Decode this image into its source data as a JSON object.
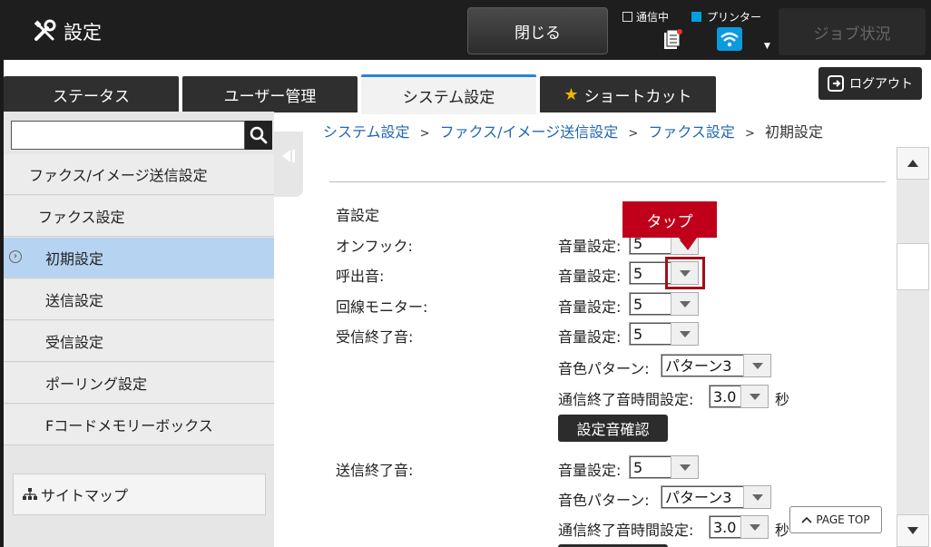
{
  "header": {
    "app_title": "設定",
    "close_label": "閉じる",
    "status_comm": "通信中",
    "status_printer": "プリンター",
    "job_status_label": "ジョブ状況"
  },
  "tabs": [
    {
      "label": "ステータス"
    },
    {
      "label": "ユーザー管理"
    },
    {
      "label": "システム設定"
    },
    {
      "label": "ショートカット"
    }
  ],
  "logout_label": "ログアウト",
  "search": {
    "value": "",
    "placeholder": ""
  },
  "sidebar": {
    "items": [
      {
        "label": "ファクス/イメージ送信設定"
      },
      {
        "label": "ファクス設定"
      },
      {
        "label": "初期設定"
      },
      {
        "label": "送信設定"
      },
      {
        "label": "受信設定"
      },
      {
        "label": "ポーリング設定"
      },
      {
        "label": "Fコードメモリーボックス"
      }
    ],
    "sitemap_label": "サイトマップ"
  },
  "breadcrumb": {
    "items": [
      "システム設定",
      "ファクス/イメージ送信設定",
      "ファクス設定"
    ],
    "separator": ">",
    "current": "初期設定"
  },
  "content": {
    "section_title": "音設定",
    "volume_label": "音量設定:",
    "pattern_label": "音色パターン:",
    "duration_label": "通信終了音時間設定:",
    "seconds_unit": "秒",
    "check_button": "設定音確認",
    "rows": {
      "on_hook": {
        "label": "オンフック:",
        "volume": "5"
      },
      "ring": {
        "label": "呼出音:",
        "volume": "5"
      },
      "line_monitor": {
        "label": "回線モニター:",
        "volume": "5"
      },
      "receive_end": {
        "label": "受信終了音:",
        "volume": "5",
        "pattern": "パターン3",
        "duration": "3.0"
      },
      "send_end": {
        "label": "送信終了音:",
        "volume": "5",
        "pattern": "パターン3",
        "duration": "3.0"
      }
    }
  },
  "callout": {
    "label": "タップ"
  },
  "page_top_label": "PAGE TOP",
  "colors": {
    "accent_tab": "#2d85c8",
    "callout": "#c0001a",
    "link": "#2267b4",
    "active_item": "#b6d4f2"
  }
}
